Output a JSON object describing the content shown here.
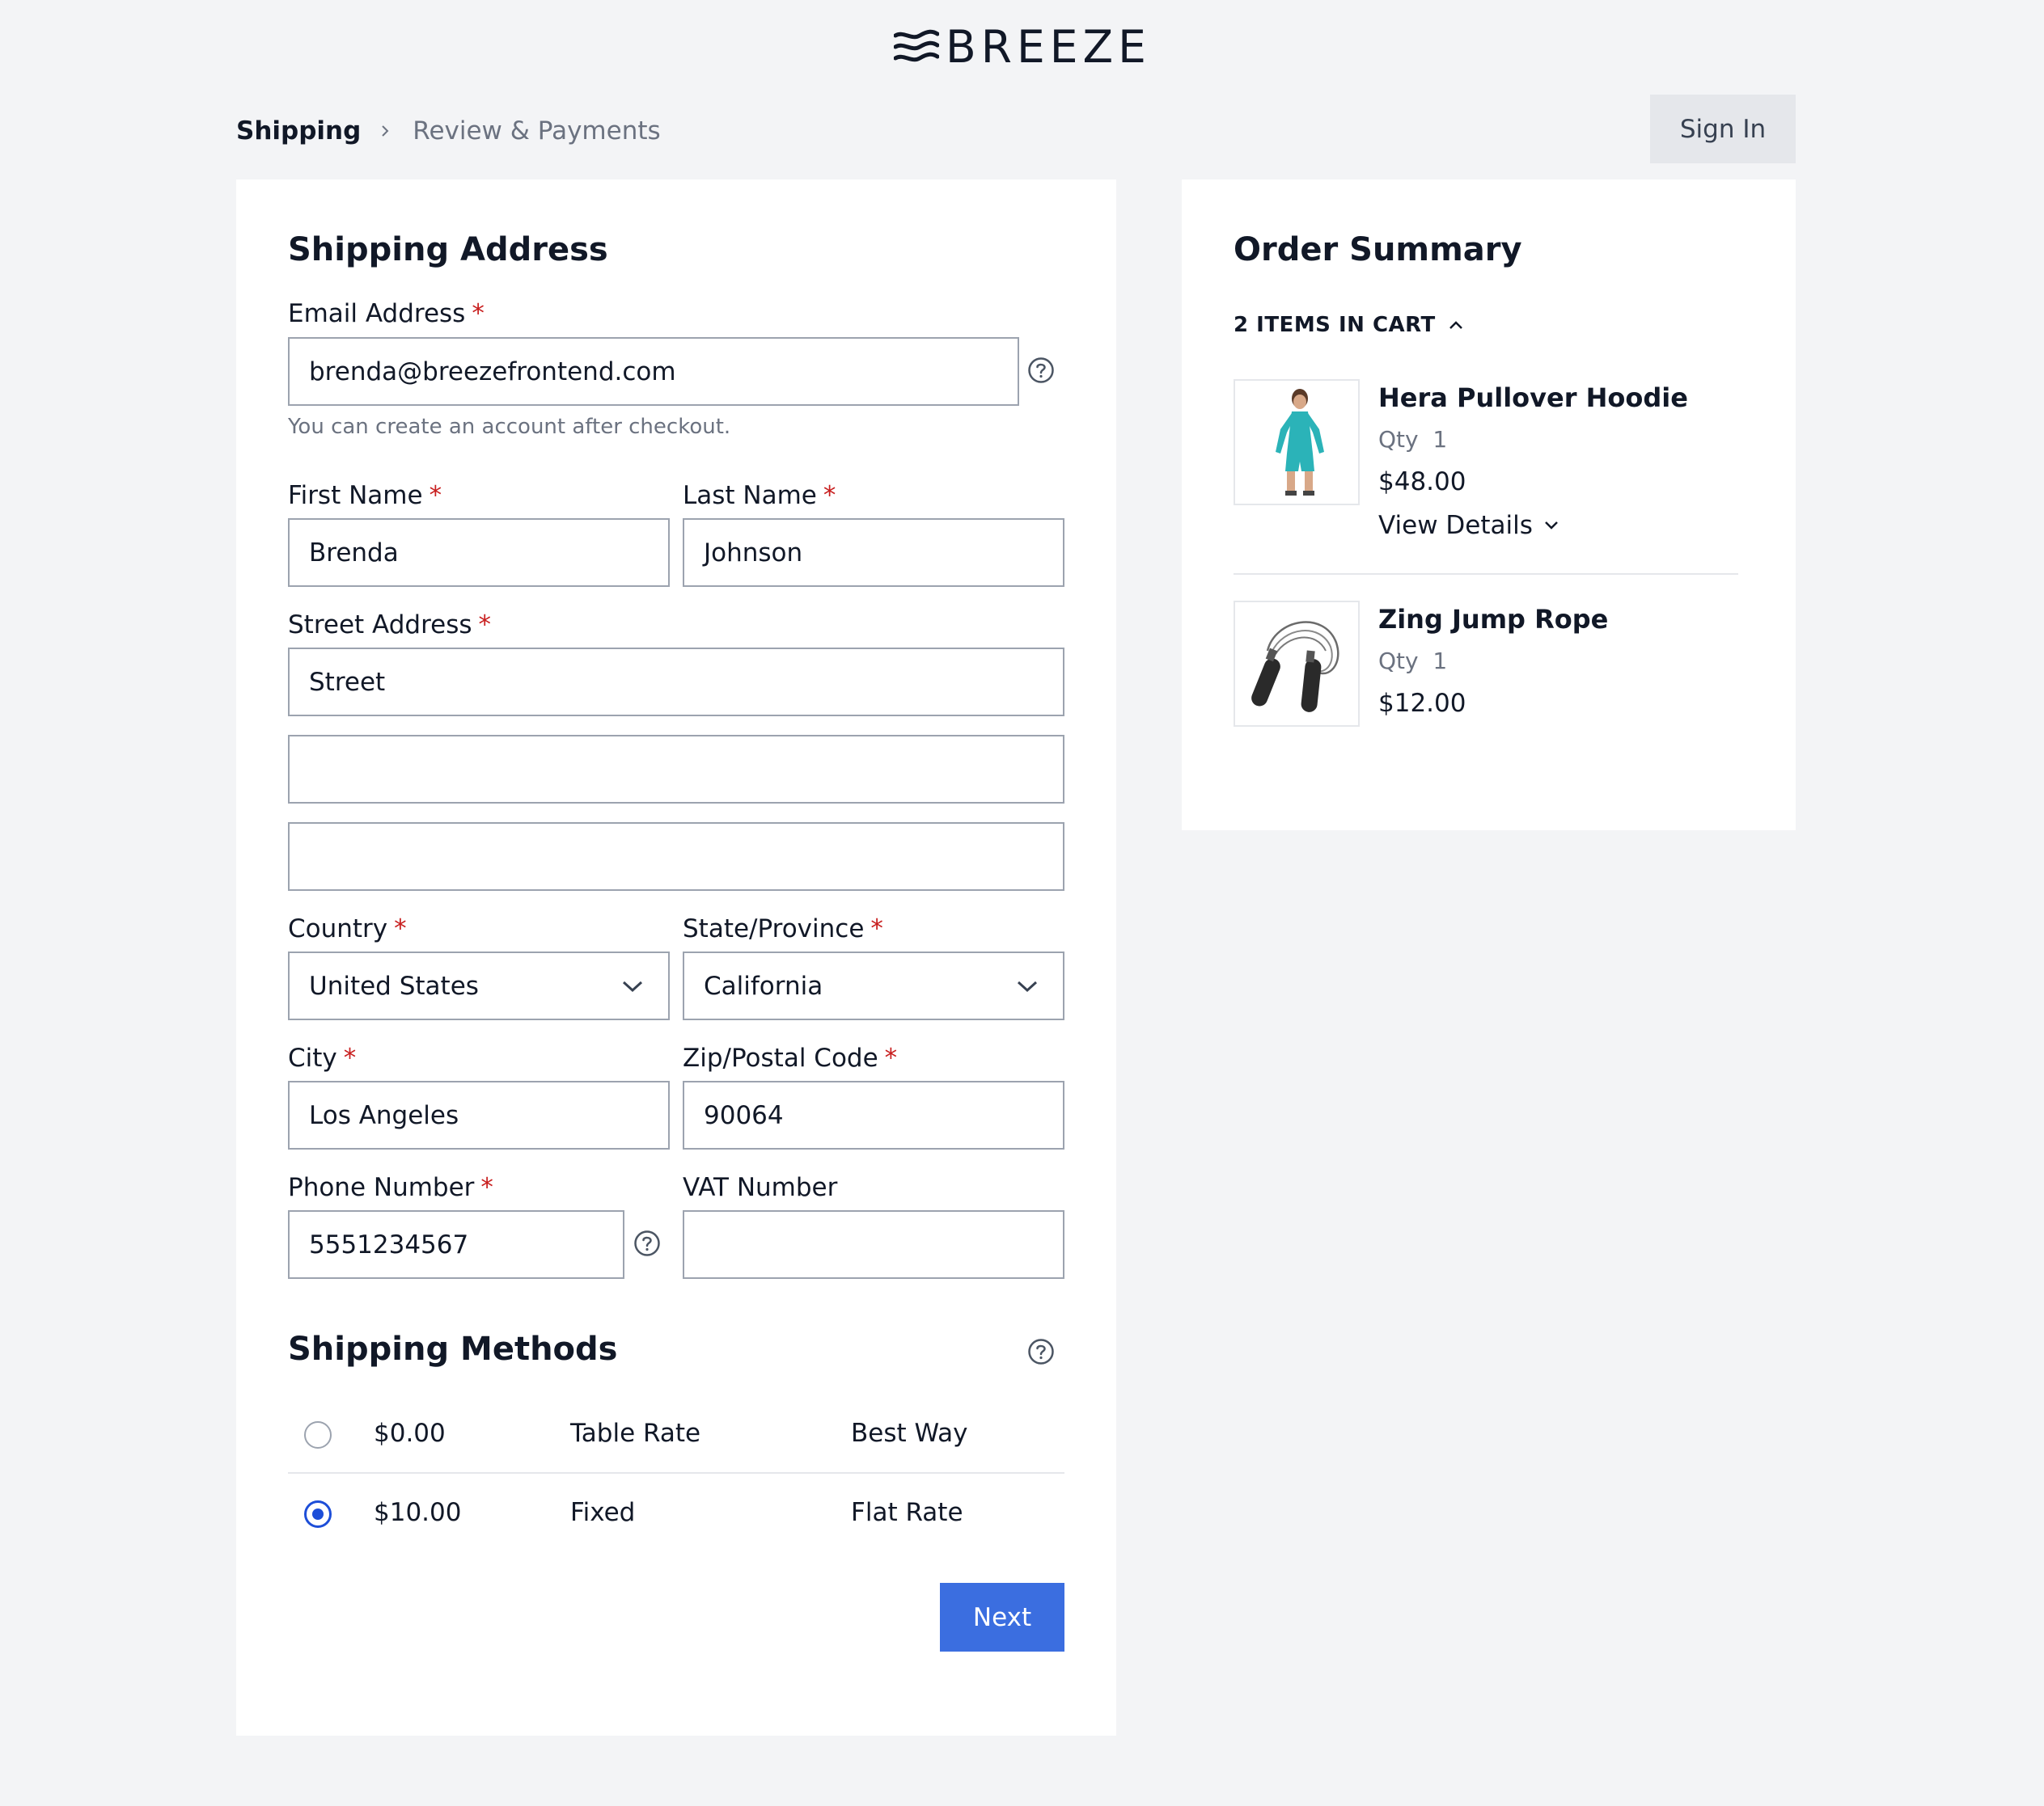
{
  "brand": {
    "name": "BREEZE"
  },
  "breadcrumb": {
    "current": "Shipping",
    "next": "Review & Payments"
  },
  "header": {
    "sign_in_label": "Sign In"
  },
  "shipping_address": {
    "title": "Shipping Address",
    "email": {
      "label": "Email Address",
      "value": "brenda@breezefrontend.com",
      "note": "You can create an account after checkout."
    },
    "first_name": {
      "label": "First Name",
      "value": "Brenda"
    },
    "last_name": {
      "label": "Last Name",
      "value": "Johnson"
    },
    "street": {
      "label": "Street Address",
      "line1": "Street",
      "line2": "",
      "line3": ""
    },
    "country": {
      "label": "Country",
      "value": "United States"
    },
    "state": {
      "label": "State/Province",
      "value": "California"
    },
    "city": {
      "label": "City",
      "value": "Los Angeles"
    },
    "zip": {
      "label": "Zip/Postal Code",
      "value": "90064"
    },
    "phone": {
      "label": "Phone Number",
      "value": "5551234567"
    },
    "vat": {
      "label": "VAT Number",
      "value": ""
    },
    "required_marker": "*"
  },
  "shipping_methods": {
    "title": "Shipping Methods",
    "options": [
      {
        "price": "$0.00",
        "method": "Table Rate",
        "carrier": "Best Way",
        "selected": false
      },
      {
        "price": "$10.00",
        "method": "Fixed",
        "carrier": "Flat Rate",
        "selected": true
      }
    ],
    "next_label": "Next"
  },
  "order_summary": {
    "title": "Order Summary",
    "items_count_label": "2 ITEMS IN CART",
    "items": [
      {
        "name": "Hera Pullover Hoodie",
        "qty_label": "Qty",
        "qty": "1",
        "price": "$48.00",
        "details_label": "View Details"
      },
      {
        "name": "Zing Jump Rope",
        "qty_label": "Qty",
        "qty": "1",
        "price": "$12.00"
      }
    ]
  },
  "colors": {
    "accent": "#3b6ee0",
    "required": "#c81e1e",
    "background": "#f3f4f6",
    "product_teal": "#2bb3b8"
  }
}
